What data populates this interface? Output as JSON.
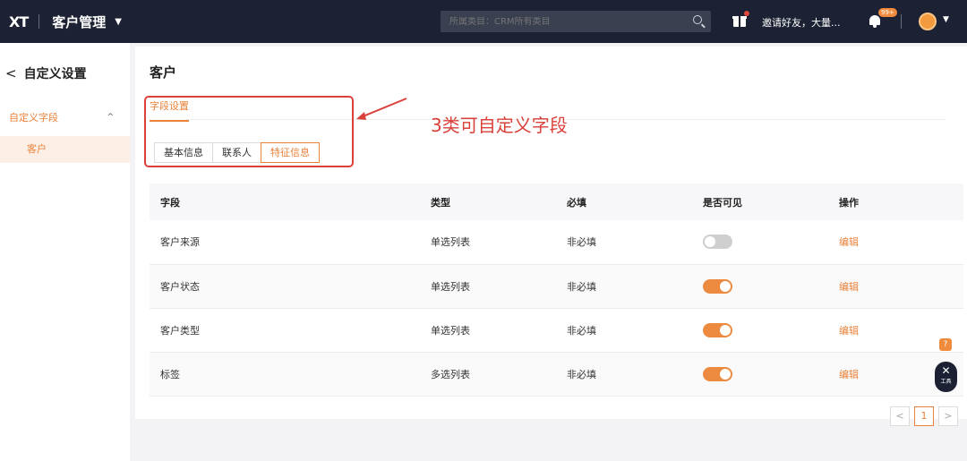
{
  "header": {
    "logo": "XT",
    "app_title": "客户管理",
    "search_placeholder": "所属类目：CRM所有类目",
    "invite_text": "邀请好友，大量...",
    "notification_badge": "99+"
  },
  "sidebar": {
    "back_title": "自定义设置",
    "group_label": "自定义字段",
    "items": [
      {
        "label": "客户"
      }
    ]
  },
  "main": {
    "title": "客户",
    "tab_label": "字段设置",
    "segments": [
      "基本信息",
      "联系人",
      "特征信息"
    ],
    "active_segment": "特征信息",
    "annotation": "3类可自定义字段",
    "table": {
      "columns": [
        "字段",
        "类型",
        "必填",
        "是否可见",
        "操作"
      ],
      "rows": [
        {
          "field": "客户来源",
          "type": "单选列表",
          "required": "非必填",
          "visible": false,
          "action": "编辑"
        },
        {
          "field": "客户状态",
          "type": "单选列表",
          "required": "非必填",
          "visible": true,
          "action": "编辑"
        },
        {
          "field": "客户类型",
          "type": "单选列表",
          "required": "非必填",
          "visible": true,
          "action": "编辑"
        },
        {
          "field": "标签",
          "type": "多选列表",
          "required": "非必填",
          "visible": true,
          "action": "编辑"
        }
      ]
    },
    "pagination": {
      "prev": "<",
      "current": "1",
      "next": ">"
    }
  },
  "floating": {
    "help": "?",
    "tool_label": "工具"
  },
  "colors": {
    "accent": "#e9823b",
    "topbar": "#1c2233",
    "annotation": "#d9413a"
  }
}
